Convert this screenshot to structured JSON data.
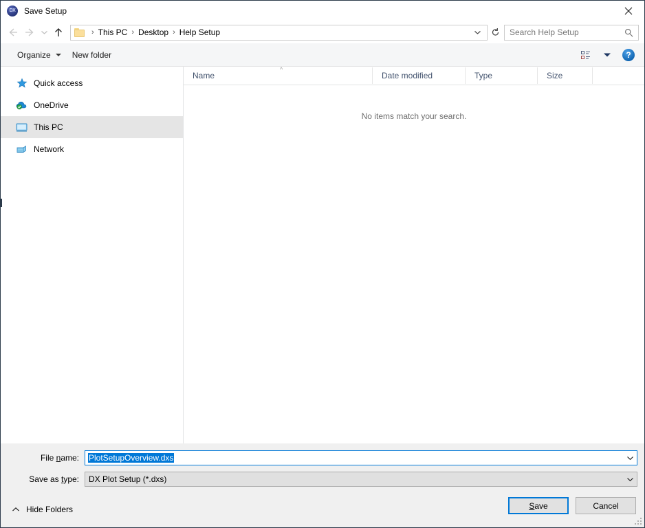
{
  "window": {
    "title": "Save Setup",
    "app_icon": "dx-app-icon",
    "close_label": "✕"
  },
  "address_bar": {
    "back_icon": "back-arrow-icon",
    "forward_icon": "forward-arrow-icon",
    "recent_icon": "chevron-down-icon",
    "up_icon": "up-arrow-icon",
    "folder_icon": "folder-icon",
    "breadcrumbs": [
      "This PC",
      "Desktop",
      "Help Setup"
    ],
    "separator": "›",
    "dropdown_icon": "chevron-down-icon",
    "refresh_icon": "refresh-icon",
    "search": {
      "placeholder": "Search Help Setup",
      "value": "",
      "icon": "search-icon"
    }
  },
  "toolbar": {
    "organize_label": "Organize",
    "new_folder_label": "New folder",
    "view_icon": "view-layout-icon",
    "view_dropdown_icon": "chevron-down-icon",
    "help_label": "?"
  },
  "sidebar": {
    "items": [
      {
        "label": "Quick access",
        "icon": "star-icon",
        "selected": false
      },
      {
        "label": "OneDrive",
        "icon": "cloud-icon",
        "selected": false
      },
      {
        "label": "This PC",
        "icon": "monitor-icon",
        "selected": true
      },
      {
        "label": "Network",
        "icon": "network-icon",
        "selected": false
      }
    ]
  },
  "file_list": {
    "columns": [
      "Name",
      "Date modified",
      "Type",
      "Size"
    ],
    "sort_indicator": "^",
    "rows": [],
    "empty_message": "No items match your search."
  },
  "form": {
    "file_name_label_pre": "File ",
    "file_name_label_key": "n",
    "file_name_label_post": "ame:",
    "file_name_value": "PlotSetupOverview.dxs",
    "save_as_type_label_pre": "Save as ",
    "save_as_type_label_key": "t",
    "save_as_type_label_post": "ype:",
    "save_as_type_value": "DX Plot Setup (*.dxs)",
    "dropdown_icon": "chevron-down-icon"
  },
  "footer": {
    "hide_folders_label": "Hide Folders",
    "hide_folders_icon": "chevron-up-icon",
    "save_label_pre": "",
    "save_label_key": "S",
    "save_label_post": "ave",
    "cancel_label": "Cancel"
  },
  "colors": {
    "accent": "#0078d7",
    "window_chrome": "#f0f0f0",
    "selection": "#0078d7",
    "header_text": "#44546f"
  }
}
